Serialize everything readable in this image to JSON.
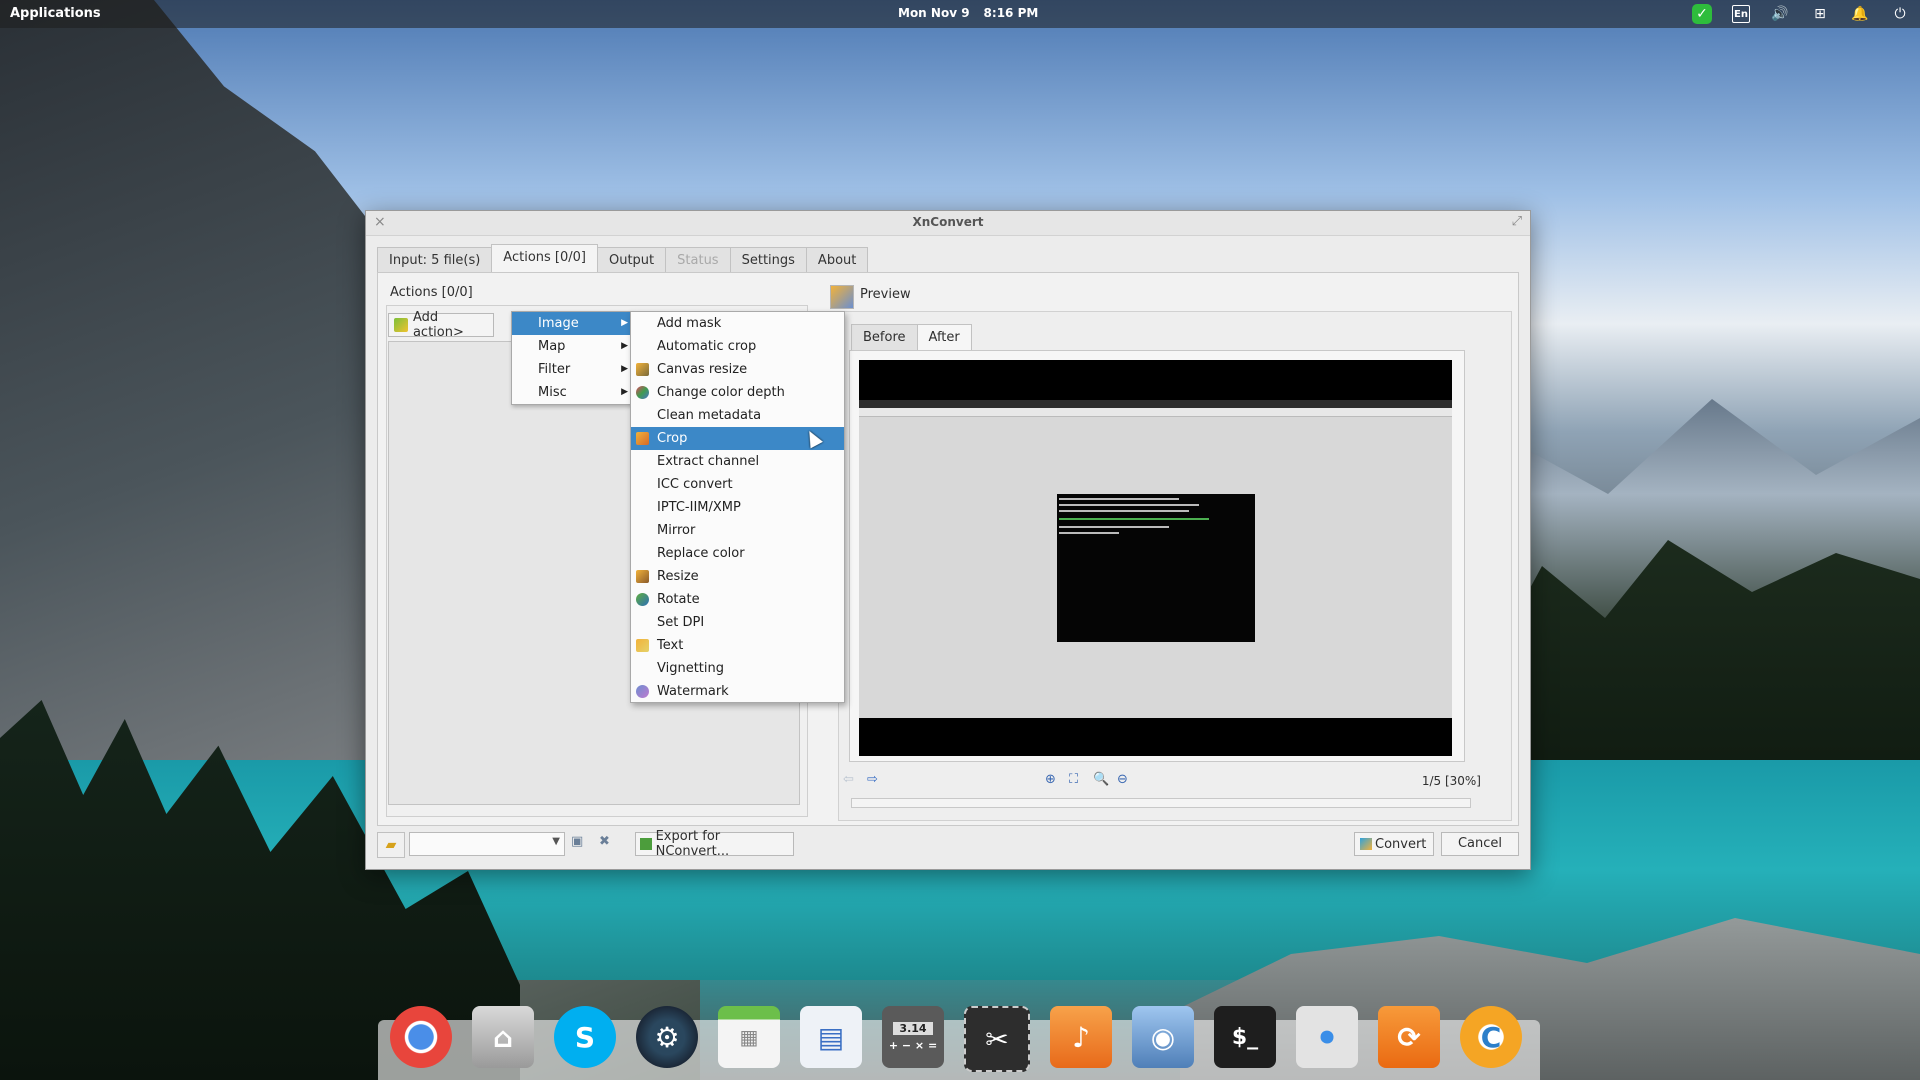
{
  "top_panel": {
    "applications": "Applications",
    "date": "Mon Nov  9",
    "time": "8:16 PM",
    "keyboard_layout": "En"
  },
  "window": {
    "title": "XnConvert",
    "tabs": [
      {
        "label": "Input: 5 file(s)",
        "state": "normal"
      },
      {
        "label": "Actions [0/0]",
        "state": "active"
      },
      {
        "label": "Output",
        "state": "normal"
      },
      {
        "label": "Status",
        "state": "disabled"
      },
      {
        "label": "Settings",
        "state": "normal"
      },
      {
        "label": "About",
        "state": "normal"
      }
    ],
    "actions_label": "Actions [0/0]",
    "add_action_label": "Add action>",
    "preview_label": "Preview",
    "preview_tabs": [
      "Before",
      "After"
    ],
    "page_info": "1/5 [30%]",
    "export_label": "Export for NConvert...",
    "convert_label": "Convert",
    "cancel_label": "Cancel"
  },
  "menu_categories": [
    {
      "label": "Image",
      "selected": true
    },
    {
      "label": "Map",
      "selected": false
    },
    {
      "label": "Filter",
      "selected": false
    },
    {
      "label": "Misc",
      "selected": false
    }
  ],
  "image_submenu": [
    {
      "label": "Add mask",
      "icon": "",
      "selected": false
    },
    {
      "label": "Automatic crop",
      "icon": "",
      "selected": false
    },
    {
      "label": "Canvas resize",
      "icon": "canvas-resize-icon",
      "selected": false
    },
    {
      "label": "Change color depth",
      "icon": "color-depth-icon",
      "selected": false
    },
    {
      "label": "Clean metadata",
      "icon": "",
      "selected": false
    },
    {
      "label": "Crop",
      "icon": "crop-icon",
      "selected": true
    },
    {
      "label": "Extract channel",
      "icon": "",
      "selected": false
    },
    {
      "label": "ICC convert",
      "icon": "",
      "selected": false
    },
    {
      "label": "IPTC-IIM/XMP",
      "icon": "",
      "selected": false
    },
    {
      "label": "Mirror",
      "icon": "",
      "selected": false
    },
    {
      "label": "Replace color",
      "icon": "",
      "selected": false
    },
    {
      "label": "Resize",
      "icon": "resize-icon",
      "selected": false
    },
    {
      "label": "Rotate",
      "icon": "rotate-icon",
      "selected": false
    },
    {
      "label": "Set DPI",
      "icon": "",
      "selected": false
    },
    {
      "label": "Text",
      "icon": "text-icon",
      "selected": false
    },
    {
      "label": "Vignetting",
      "icon": "",
      "selected": false
    },
    {
      "label": "Watermark",
      "icon": "watermark-icon",
      "selected": false
    }
  ],
  "dock": {
    "apps": [
      {
        "name": "chrome",
        "color": "#e8453c"
      },
      {
        "name": "home-folder",
        "color": "#8a8a8a"
      },
      {
        "name": "skype",
        "color": "#00aff0"
      },
      {
        "name": "steam",
        "color": "#1b2838"
      },
      {
        "name": "calendar",
        "color": "#6cbf4a"
      },
      {
        "name": "document-viewer",
        "color": "#e9eef5"
      },
      {
        "name": "calculator",
        "color": "#5a5a5a"
      },
      {
        "name": "screenshot",
        "color": "#2d2d2d"
      },
      {
        "name": "music",
        "color": "#f58a24"
      },
      {
        "name": "image-viewer",
        "color": "#5e8fc8"
      },
      {
        "name": "terminal",
        "color": "#1e1e1e"
      },
      {
        "name": "settings-toggle",
        "color": "#d8d8d8"
      },
      {
        "name": "updater",
        "color": "#f47a20"
      },
      {
        "name": "xnconvert",
        "color": "#f5a524"
      }
    ],
    "calculator_display": "3.14",
    "terminal_prompt": "$_"
  }
}
